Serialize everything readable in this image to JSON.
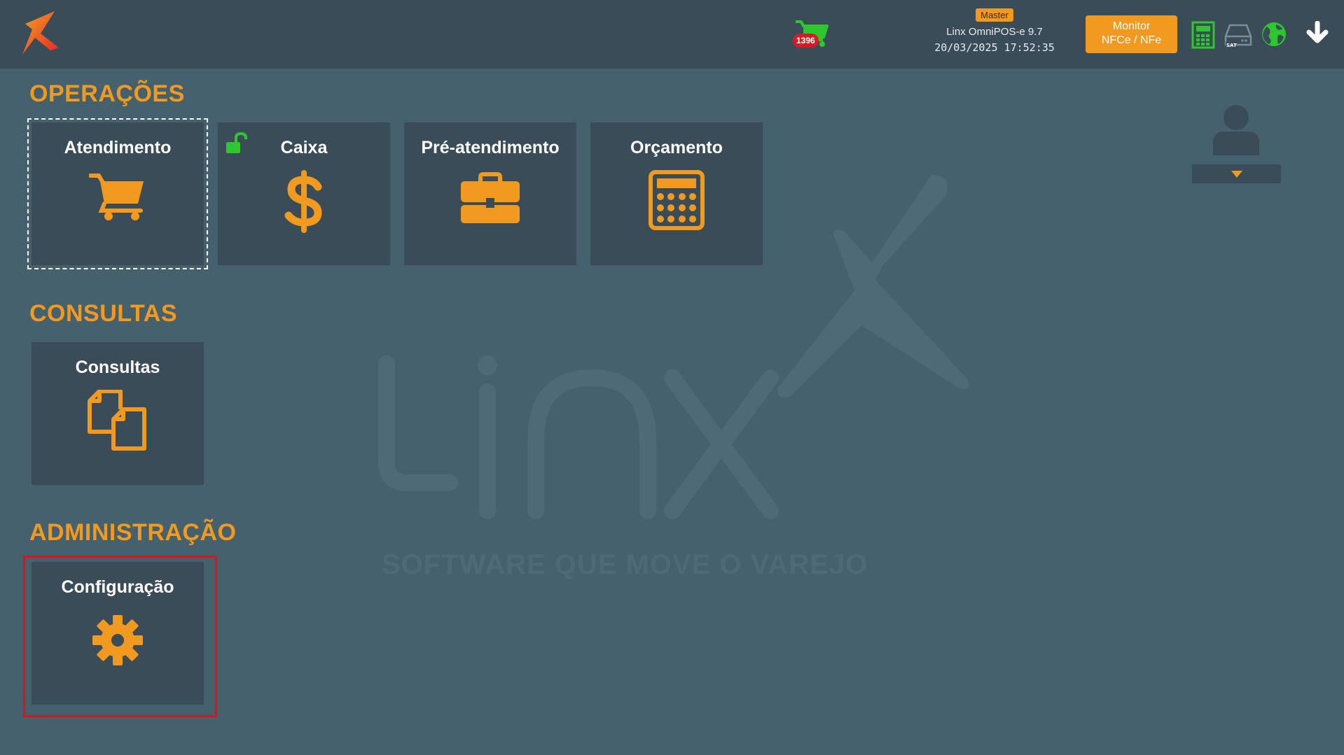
{
  "header": {
    "cart_count": "1396",
    "user_role": "Master",
    "app_name": "Linx OmniPOS-e  9.7",
    "datetime": "20/03/2025 17:52:35",
    "monitor_button": {
      "line1": "Monitor",
      "line2": "NFCe / NFe"
    },
    "icons": [
      "logo-icon",
      "cart-icon",
      "fiscal-printer-icon",
      "sat-icon",
      "globe-icon",
      "download-icon"
    ]
  },
  "sections": {
    "operacoes": {
      "title": "OPERAÇÕES",
      "tiles": [
        {
          "label": "Atendimento",
          "icon": "shopping-cart-icon"
        },
        {
          "label": "Caixa",
          "icon": "dollar-icon"
        },
        {
          "label": "Pré-atendimento",
          "icon": "briefcase-icon"
        },
        {
          "label": "Orçamento",
          "icon": "calculator-icon"
        }
      ]
    },
    "consultas": {
      "title": "CONSULTAS",
      "tiles": [
        {
          "label": "Consultas",
          "icon": "documents-icon"
        }
      ]
    },
    "administracao": {
      "title": "ADMINISTRAÇÃO",
      "tiles": [
        {
          "label": "Configuração",
          "icon": "gear-icon"
        }
      ]
    }
  },
  "watermark": {
    "brand": "Linx",
    "tagline": "SOFTWARE QUE MOVE O VAREJO"
  },
  "colors": {
    "accent": "#f29a1f",
    "background": "#46616e",
    "panel": "#3a4c58",
    "status_ok": "#2ec82e",
    "highlight": "#e3101b"
  }
}
